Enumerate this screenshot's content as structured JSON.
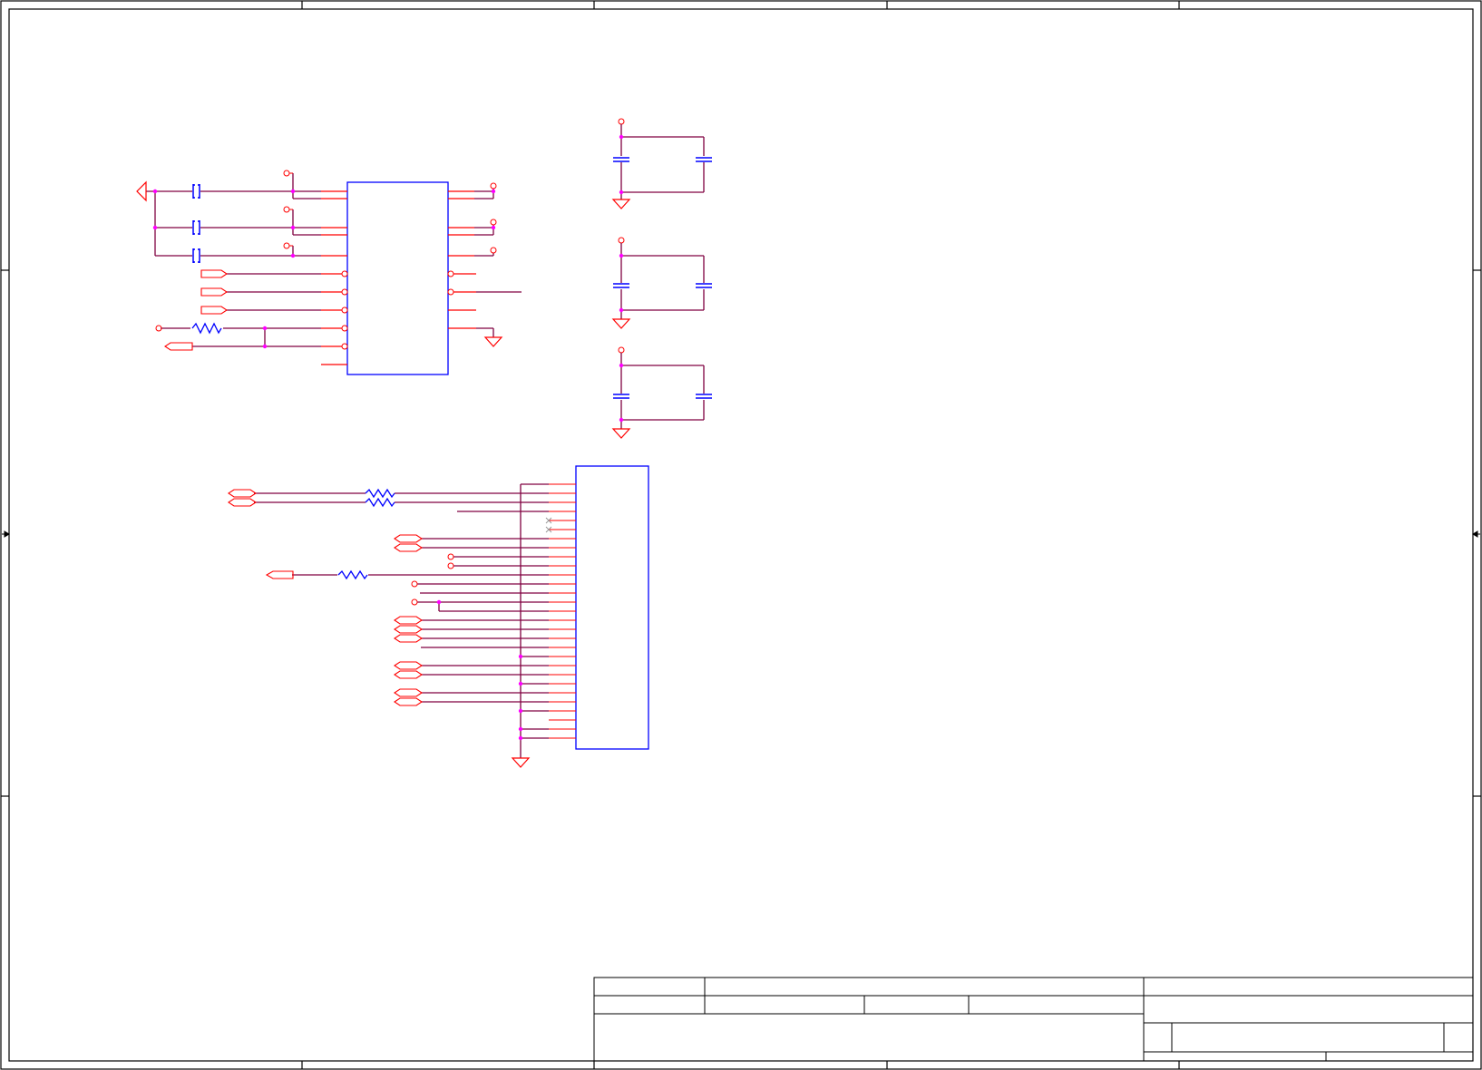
{
  "colors": {
    "background": "#ffffff",
    "frame": "#000000",
    "wire": "#800040",
    "pin": "#ff0000",
    "component_body": "#0000ff",
    "junction": "#ff00ff",
    "passive": "#0000ff"
  },
  "sheet": {
    "zone_labels": [],
    "title_block": {
      "title": "",
      "company": "",
      "size": "",
      "document_number": "",
      "revision": "",
      "date": "",
      "sheet": ""
    }
  },
  "components": {
    "ic_top": {
      "reference": "",
      "value": ""
    },
    "connector": {
      "reference": "",
      "value": ""
    }
  }
}
